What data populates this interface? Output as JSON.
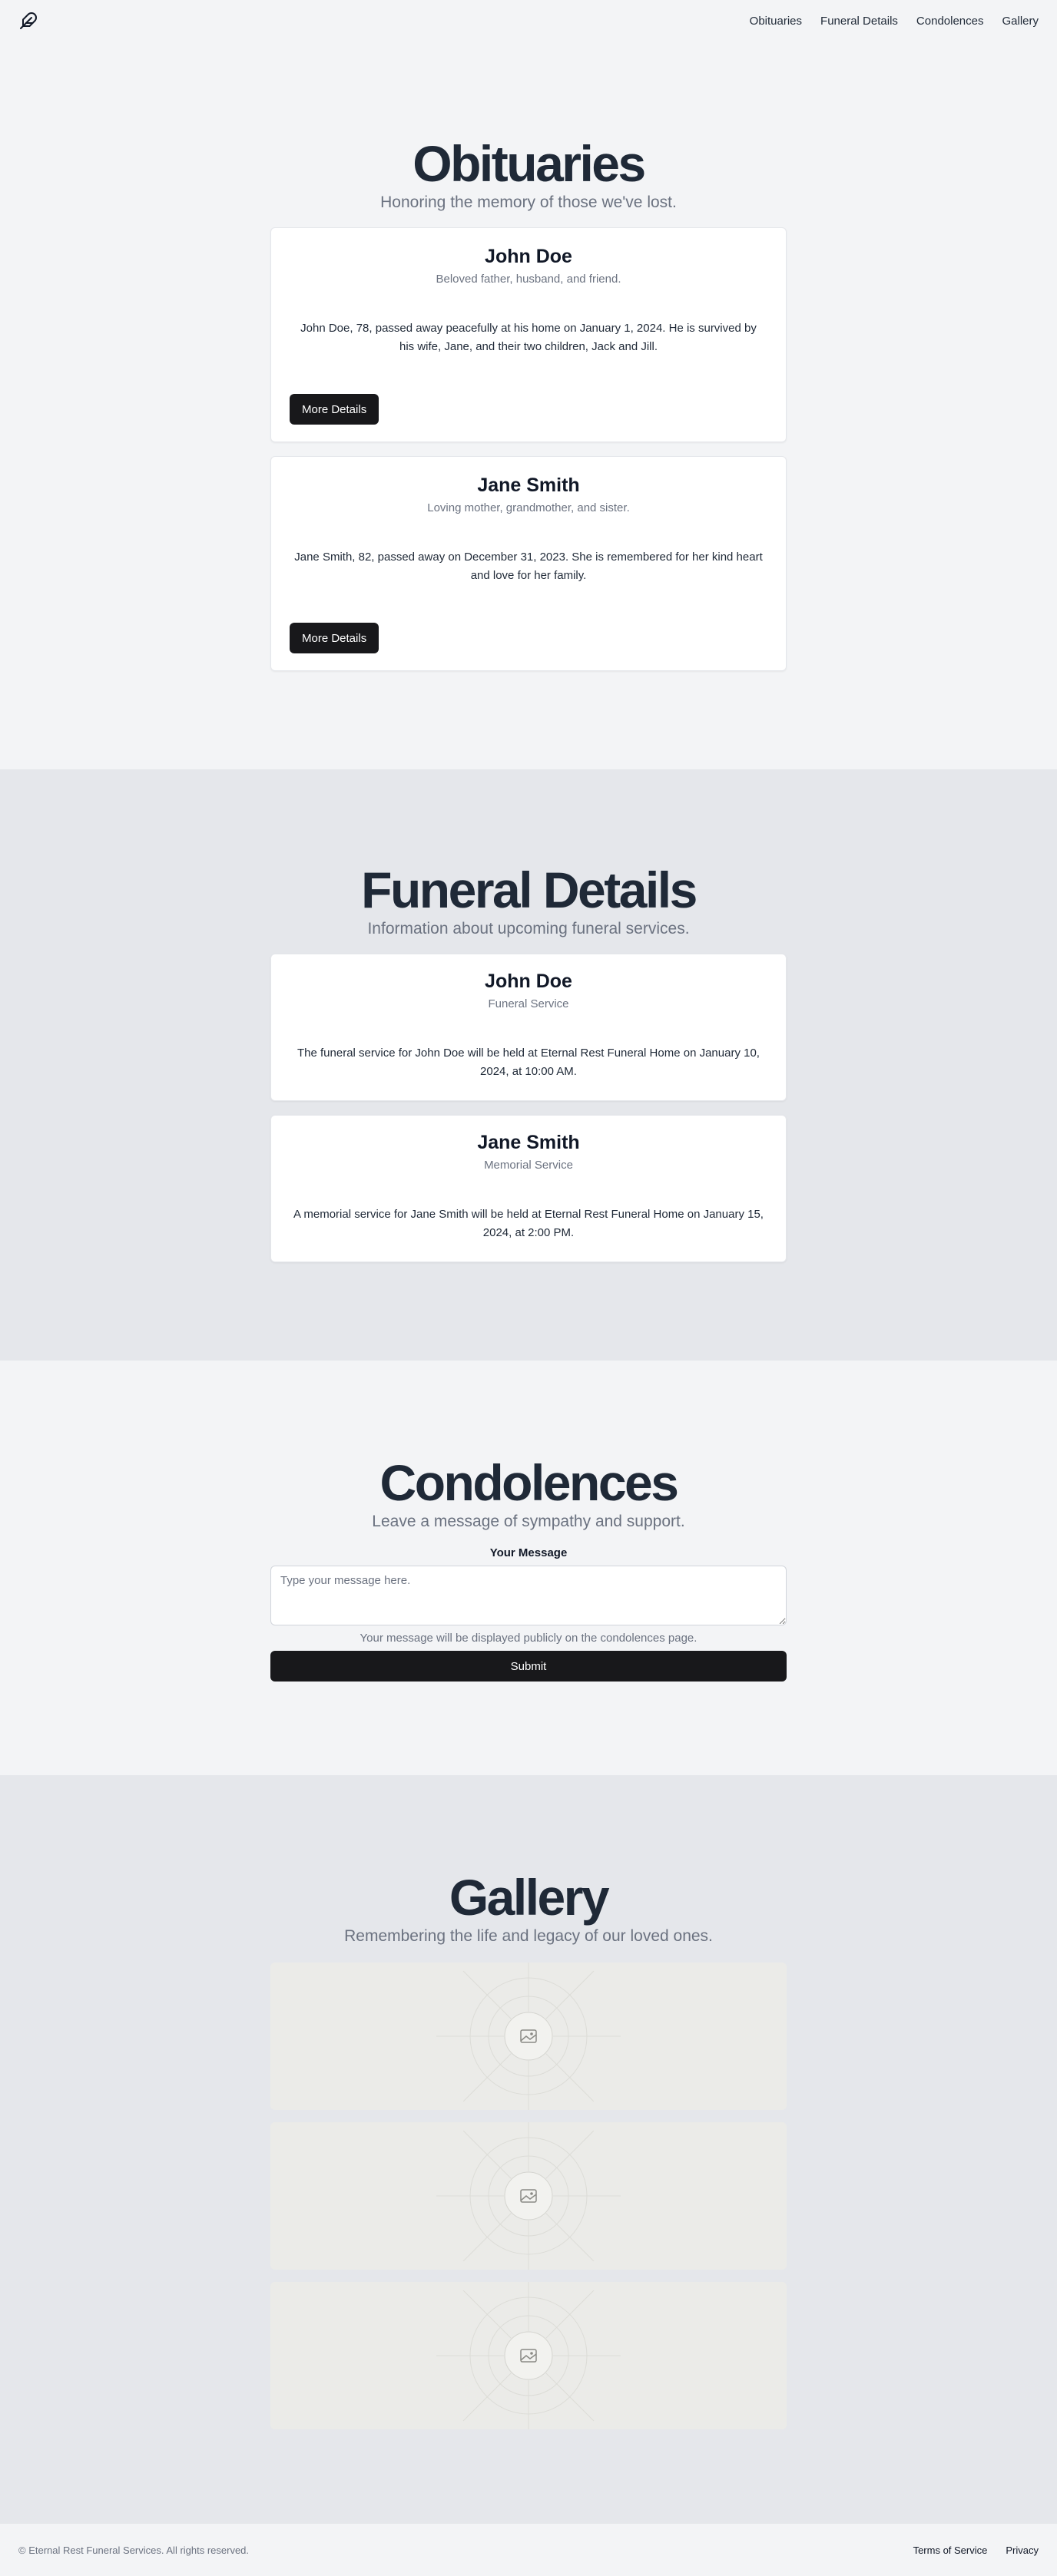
{
  "nav": {
    "logo_icon": "feather-icon",
    "links": [
      "Obituaries",
      "Funeral Details",
      "Condolences",
      "Gallery"
    ]
  },
  "obituaries": {
    "title": "Obituaries",
    "subtitle": "Honoring the memory of those we've lost.",
    "cards": [
      {
        "name": "John Doe",
        "tagline": "Beloved father, husband, and friend.",
        "text": "John Doe, 78, passed away peacefully at his home on January 1, 2024. He is survived by his wife, Jane, and their two children, Jack and Jill.",
        "button": "More Details"
      },
      {
        "name": "Jane Smith",
        "tagline": "Loving mother, grandmother, and sister.",
        "text": "Jane Smith, 82, passed away on December 31, 2023. She is remembered for her kind heart and love for her family.",
        "button": "More Details"
      }
    ]
  },
  "funeral": {
    "title": "Funeral Details",
    "subtitle": "Information about upcoming funeral services.",
    "cards": [
      {
        "name": "John Doe",
        "type": "Funeral Service",
        "text": "The funeral service for John Doe will be held at Eternal Rest Funeral Home on January 10, 2024, at 10:00 AM."
      },
      {
        "name": "Jane Smith",
        "type": "Memorial Service",
        "text": "A memorial service for Jane Smith will be held at Eternal Rest Funeral Home on January 15, 2024, at 2:00 PM."
      }
    ]
  },
  "condolences": {
    "title": "Condolences",
    "subtitle": "Leave a message of sympathy and support.",
    "label": "Your Message",
    "placeholder": "Type your message here.",
    "value": "",
    "help": "Your message will be displayed publicly on the condolences page.",
    "submit": "Submit"
  },
  "gallery": {
    "title": "Gallery",
    "subtitle": "Remembering the life and legacy of our loved ones.",
    "image_icon": "image-placeholder-icon"
  },
  "footer": {
    "copyright": "© Eternal Rest Funeral Services. All rights reserved.",
    "links": [
      "Terms of Service",
      "Privacy"
    ]
  },
  "colors": {
    "page_bg": "#f3f4f6",
    "alt_bg": "#e5e7eb",
    "heading": "#1f2937",
    "muted": "#6b7280",
    "button": "#18181b"
  }
}
